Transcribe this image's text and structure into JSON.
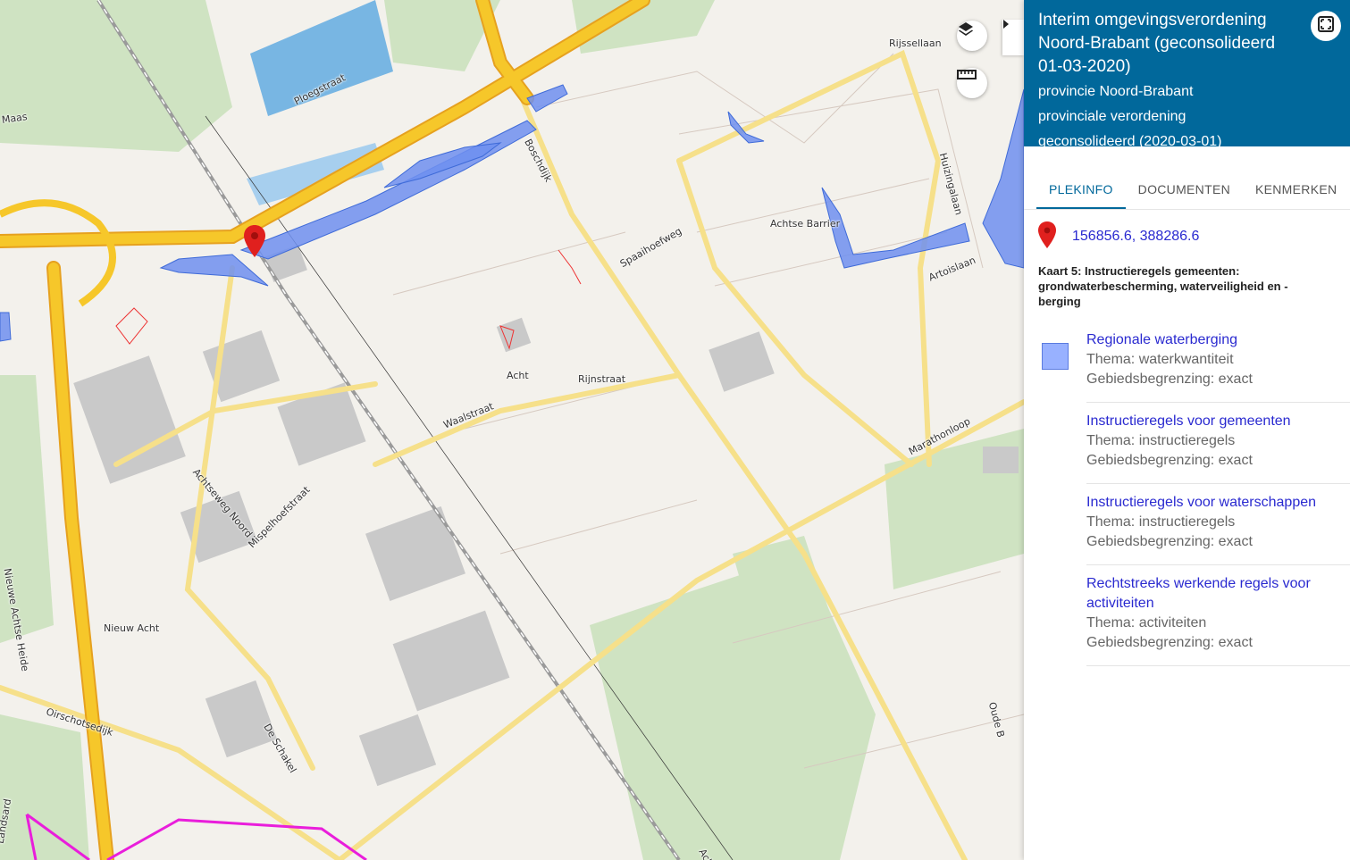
{
  "map": {
    "labels": [
      {
        "id": "maas",
        "text": "Maas"
      },
      {
        "id": "ploegstraat",
        "text": "Ploegstraat"
      },
      {
        "id": "boschdijk",
        "text": "Boschdijk"
      },
      {
        "id": "spaaihoefweg",
        "text": "Spaaihoefweg"
      },
      {
        "id": "achtse-barrier",
        "text": "Achtse Barrier"
      },
      {
        "id": "rijssellaan",
        "text": "Rijssellaan"
      },
      {
        "id": "huizingalaan",
        "text": "Huizingalaan"
      },
      {
        "id": "artoislaan",
        "text": "Artoislaan"
      },
      {
        "id": "acht",
        "text": "Acht"
      },
      {
        "id": "rijnstraat",
        "text": "Rijnstraat"
      },
      {
        "id": "waalstraat",
        "text": "Waalstraat"
      },
      {
        "id": "achtseweg-noord",
        "text": "Achtseweg Noord"
      },
      {
        "id": "mispelhoefstraat",
        "text": "Mispelhoefstraat"
      },
      {
        "id": "nieuwe-achtse-heide",
        "text": "Nieuwe Achtse Heide"
      },
      {
        "id": "nieuw-acht",
        "text": "Nieuw Acht"
      },
      {
        "id": "oirschotsedijk",
        "text": "Oirschotsedijk"
      },
      {
        "id": "de-schakel",
        "text": "De Schakel"
      },
      {
        "id": "marathonloop",
        "text": "Marathonloop"
      },
      {
        "id": "achtse",
        "text": "Achtse"
      },
      {
        "id": "oude",
        "text": "Oude B"
      },
      {
        "id": "landsard",
        "text": "Landsard"
      }
    ],
    "icons": {
      "layers": "layers-icon",
      "measure": "ruler-icon",
      "collapse": "chevron-right-icon",
      "marker": "location-pin-icon"
    },
    "colors": {
      "water_zone": "#6f8ff0",
      "motorway": "#f6c72a",
      "road": "#f6e08a",
      "boundary": "#e91edb"
    }
  },
  "panel": {
    "title": "Interim omgevingsverordening Noord-Brabant (geconsolideerd 01-03-2020)",
    "subtitle_1": "provincie Noord-Brabant",
    "subtitle_2": "provinciale verordening",
    "subtitle_3": "geconsolideerd (2020-03-01)",
    "header_color": "#01689b",
    "fullscreen_icon": "fullscreen-icon",
    "tabs": [
      {
        "label": "PLEKINFO"
      },
      {
        "label": "DOCUMENTEN"
      },
      {
        "label": "KENMERKEN"
      }
    ],
    "coordinates": "156856.6, 388286.6",
    "kaart_title": "Kaart 5: Instructieregels gemeenten: grondwaterbescherming, waterveiligheid en -berging",
    "items": [
      {
        "title": "Regionale waterberging",
        "thema": "Thema: waterkwantiteit",
        "grens": "Gebiedsbegrenzing: exact",
        "swatch": "#98b1ff"
      },
      {
        "title": "Instructieregels voor gemeenten",
        "thema": "Thema: instructieregels",
        "grens": "Gebiedsbegrenzing: exact"
      },
      {
        "title": "Instructieregels voor waterschappen",
        "thema": "Thema: instructieregels",
        "grens": "Gebiedsbegrenzing: exact"
      },
      {
        "title": "Rechtstreeks werkende regels voor activiteiten",
        "thema": "Thema: activiteiten",
        "grens": "Gebiedsbegrenzing: exact"
      }
    ]
  }
}
